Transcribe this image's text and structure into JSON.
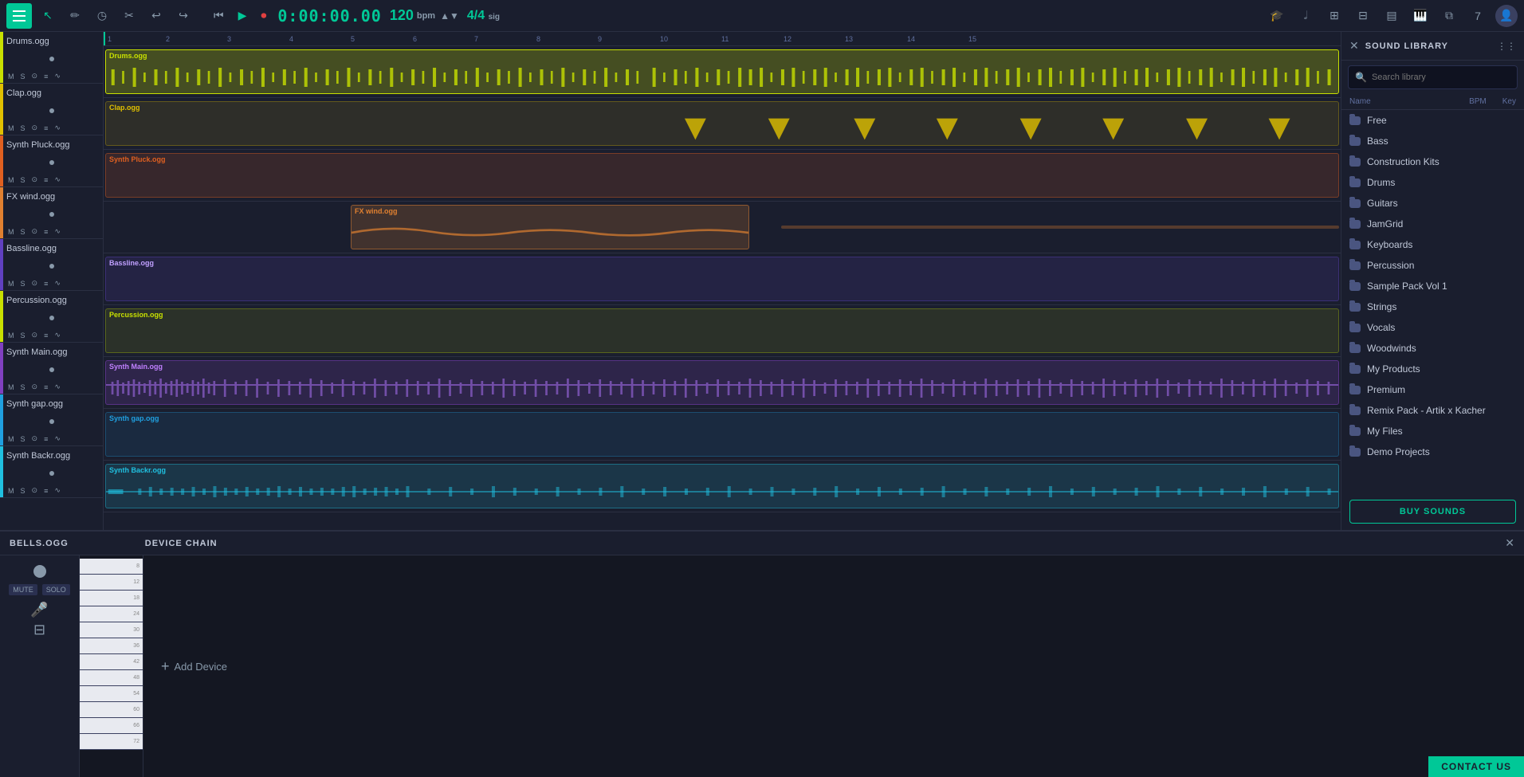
{
  "toolbar": {
    "time": "0:00:00.00",
    "bpm": "120",
    "bpm_unit": "bpm",
    "sig": "4/4",
    "sig_unit": "sig"
  },
  "tracks": [
    {
      "name": "Drums.ogg",
      "color": "#c8e000",
      "clip_color": "#c8e000",
      "type": "drums"
    },
    {
      "name": "Clap.ogg",
      "color": "#e0c000",
      "clip_color": "#e0c000",
      "type": "clap"
    },
    {
      "name": "Synth Pluck.ogg",
      "color": "#e06020",
      "clip_color": "#e06020",
      "type": "synth"
    },
    {
      "name": "FX wind.ogg",
      "color": "#e08030",
      "clip_color": "#e08030",
      "type": "fx"
    },
    {
      "name": "Bassline.ogg",
      "color": "#6040c0",
      "clip_color": "#6040c0",
      "type": "bassline"
    },
    {
      "name": "Percussion.ogg",
      "color": "#c8e000",
      "clip_color": "#c8e000",
      "type": "percussion"
    },
    {
      "name": "Synth Main.ogg",
      "color": "#8040c0",
      "clip_color": "#8040c0",
      "type": "synth"
    },
    {
      "name": "Synth gap.ogg",
      "color": "#20a0e0",
      "clip_color": "#20a0e0",
      "type": "synth"
    },
    {
      "name": "Synth Backr.ogg",
      "color": "#20c0e0",
      "clip_color": "#20c0e0",
      "type": "synth"
    }
  ],
  "sound_library": {
    "title": "SOUND LIBRARY",
    "search_placeholder": "Search library",
    "col_name": "Name",
    "col_bpm": "BPM",
    "col_key": "Key",
    "items": [
      {
        "name": "Free",
        "type": "folder"
      },
      {
        "name": "Bass",
        "type": "folder"
      },
      {
        "name": "Construction Kits",
        "type": "folder"
      },
      {
        "name": "Drums",
        "type": "folder"
      },
      {
        "name": "Guitars",
        "type": "folder"
      },
      {
        "name": "JamGrid",
        "type": "folder"
      },
      {
        "name": "Keyboards",
        "type": "folder"
      },
      {
        "name": "Percussion",
        "type": "folder"
      },
      {
        "name": "Sample Pack Vol 1",
        "type": "folder"
      },
      {
        "name": "Strings",
        "type": "folder"
      },
      {
        "name": "Vocals",
        "type": "folder"
      },
      {
        "name": "Woodwinds",
        "type": "folder"
      },
      {
        "name": "My Products",
        "type": "folder"
      },
      {
        "name": "Premium",
        "type": "folder"
      },
      {
        "name": "Remix Pack - Artik x Kacher",
        "type": "folder"
      },
      {
        "name": "My Files",
        "type": "folder"
      },
      {
        "name": "Demo Projects",
        "type": "folder"
      }
    ],
    "buy_sounds": "BUY SOUNDS"
  },
  "bottom_panel": {
    "track_name": "BELLS.OGG",
    "device_chain": "DEVICE CHAIN",
    "mute": "MUTE",
    "solo": "SOLO",
    "add_device": "Add Device",
    "close": "✕"
  },
  "contact_us": "CONTACT US"
}
